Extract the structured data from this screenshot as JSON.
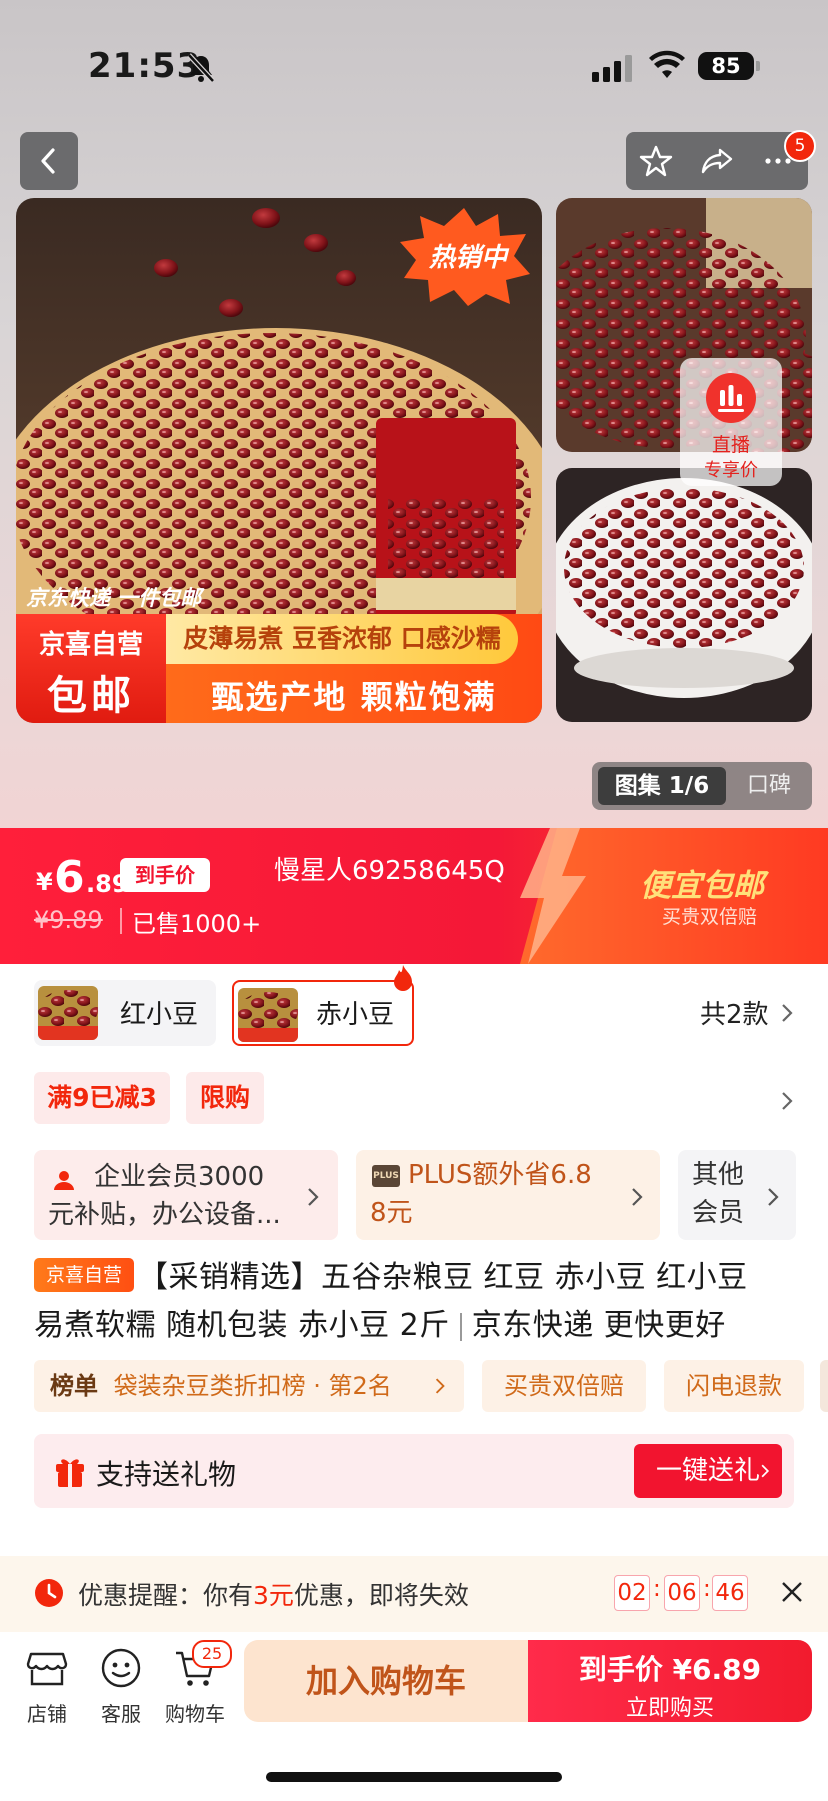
{
  "status_bar": {
    "time": "21:53",
    "battery": "85"
  },
  "header": {
    "notification_count": "5"
  },
  "hero": {
    "hot_badge": "热销中",
    "delivery_note": "京东快递 一件包邮",
    "banner_left_line1": "京喜自营",
    "banner_left_line2": "包邮",
    "slogan_top": "皮薄易煮 豆香浓郁 口感沙糯",
    "slogan_bottom": "甄选产地 颗粒饱满",
    "live_line1": "直播",
    "live_line2": "专享价",
    "gallery_label": "图集 1/6",
    "review_label": "口碑"
  },
  "price": {
    "currency": "¥",
    "integer": "6",
    "decimal": ".89",
    "tag": "到手价",
    "original": "¥9.89",
    "sold": "已售1000+",
    "shop_nick": "慢星人69258645Q",
    "cheap_title": "便宜包邮",
    "cheap_sub": "买贵双倍赔"
  },
  "sku": {
    "options": [
      {
        "label": "红小豆"
      },
      {
        "label": "赤小豆"
      }
    ],
    "total": "共2款"
  },
  "promos": [
    "满9已减3",
    "限购"
  ],
  "member_cards": {
    "enterprise_line1": "企业会员3000",
    "enterprise_line2": "元补贴，办公设备...",
    "plus_badge": "PLUS",
    "plus_line1": "PLUS额外省6.8",
    "plus_line2": "8元",
    "other_line1": "其他",
    "other_line2": "会员"
  },
  "product": {
    "tag": "京喜自营",
    "title_line1": "【采销精选】五谷杂粮豆 红豆 赤小豆 红小豆",
    "title_line2_a": "易煮软糯  随机包装 赤小豆 2斤",
    "title_line2_b": "京东快递 更快更好"
  },
  "chips": {
    "rank_title": "榜单",
    "rank_text": "袋装杂豆类折扣榜 · 第2名",
    "guarantee": "买贵双倍赔",
    "refund": "闪电退款"
  },
  "gift": {
    "text": "支持送礼物",
    "button": "一键送礼"
  },
  "reminder": {
    "prefix": "优惠提醒：你有",
    "amount": "3元",
    "suffix": "优惠，即将失效",
    "hours": "02",
    "minutes": "06",
    "seconds": "46"
  },
  "bottom_nav": {
    "store": "店铺",
    "service": "客服",
    "cart": "购物车",
    "cart_count": "25"
  },
  "actions": {
    "add_cart": "加入购物车",
    "buy_line1": "到手价 ¥6.89",
    "buy_line2": "立即购买"
  },
  "colors": {
    "accent": "#f2270c",
    "price_red": "#f41837",
    "orange": "#ff5a24"
  }
}
